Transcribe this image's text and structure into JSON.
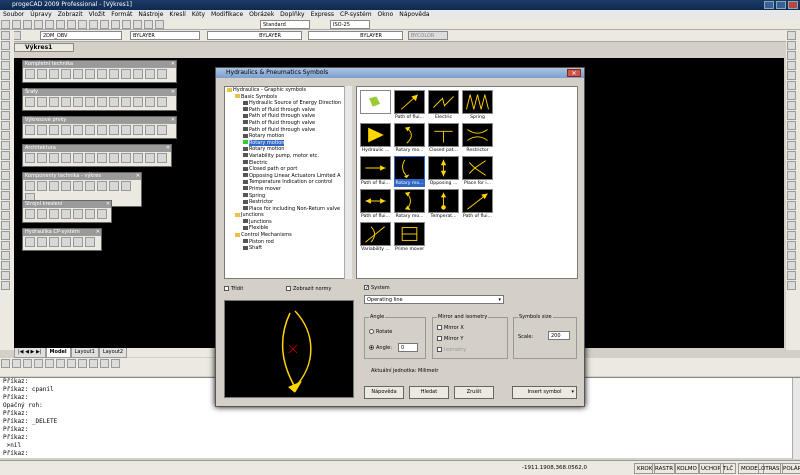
{
  "app": {
    "title": "progeCAD 2009 Professional - [Výkres1]"
  },
  "menu": [
    "Soubor",
    "Úpravy",
    "Zobrazit",
    "Vložit",
    "Formát",
    "Nástroje",
    "Kreslí",
    "Kóty",
    "Modifikace",
    "Obrázek",
    "Doplňky",
    "Express",
    "CP-systém",
    "Okno",
    "Nápověda"
  ],
  "toolbar": {
    "layer": "2DM_OBV",
    "color": "BYLAYER",
    "linetype": "BYLAYER",
    "lineweight": "BYLAYER",
    "plotstyle": "BYCOLOR",
    "textstyle": "Standard",
    "dimstyle": "ISO-25"
  },
  "doc_tab": "Výkres1",
  "palettes": [
    "Kompletní technika",
    "Šrafy",
    "Výkresové prvky",
    "Architektura",
    "Komponenty technika - výkres",
    "Strojní kreslení",
    "Hydraulika CP-systém"
  ],
  "dialog": {
    "title": "Hydraulics & Pneumatics Symbols",
    "tree": [
      {
        "label": "Hydraulics - Graphic symbols",
        "lvl": 0,
        "type": "folder"
      },
      {
        "label": "Basic Symbols",
        "lvl": 1,
        "type": "folder"
      },
      {
        "label": "Hydraulic Source of Energy Direction",
        "lvl": 2,
        "type": "item"
      },
      {
        "label": "Path of fluid through valve",
        "lvl": 2,
        "type": "item"
      },
      {
        "label": "Path of fluid through valve",
        "lvl": 2,
        "type": "item"
      },
      {
        "label": "Path of fluid through valve",
        "lvl": 2,
        "type": "item"
      },
      {
        "label": "Path of fluid through valve",
        "lvl": 2,
        "type": "item"
      },
      {
        "label": "Rotary motion",
        "lvl": 2,
        "type": "item"
      },
      {
        "label": "Rotary motion",
        "lvl": 2,
        "type": "item",
        "selected": true
      },
      {
        "label": "Rotary motion",
        "lvl": 2,
        "type": "item"
      },
      {
        "label": "Variability pump, motor etc.",
        "lvl": 2,
        "type": "item"
      },
      {
        "label": "Electric",
        "lvl": 2,
        "type": "item"
      },
      {
        "label": "Closed path or port",
        "lvl": 2,
        "type": "item"
      },
      {
        "label": "Opposing Linear Actuators Limited A",
        "lvl": 2,
        "type": "item"
      },
      {
        "label": "Temperature Indication or control",
        "lvl": 2,
        "type": "item"
      },
      {
        "label": "Prime mover",
        "lvl": 2,
        "type": "item"
      },
      {
        "label": "Spring",
        "lvl": 2,
        "type": "item"
      },
      {
        "label": "Restrictor",
        "lvl": 2,
        "type": "item"
      },
      {
        "label": "Place for including Non-Return valve",
        "lvl": 2,
        "type": "item"
      },
      {
        "label": "Junctions",
        "lvl": 1,
        "type": "folder"
      },
      {
        "label": "Junctions",
        "lvl": 2,
        "type": "item"
      },
      {
        "label": "Flexible",
        "lvl": 2,
        "type": "item"
      },
      {
        "label": "Control Mechanisms",
        "lvl": 1,
        "type": "folder"
      },
      {
        "label": "Piston rod",
        "lvl": 2,
        "type": "item"
      },
      {
        "label": "Shaft",
        "lvl": 2,
        "type": "item"
      }
    ],
    "symbols": [
      {
        "label": "",
        "kind": "open"
      },
      {
        "label": "Path of flui...",
        "kind": "arrow-diag"
      },
      {
        "label": "Electric",
        "kind": "electric"
      },
      {
        "label": "Spring",
        "kind": "spring"
      },
      {
        "label": "Hydraulic ...",
        "kind": "triangle"
      },
      {
        "label": "Rotary mo...",
        "kind": "arc"
      },
      {
        "label": "Closed pat...",
        "kind": "tee"
      },
      {
        "label": "Restrictor",
        "kind": "restrictor"
      },
      {
        "label": "Path of flui...",
        "kind": "arrow-h"
      },
      {
        "label": "Rotary mo...",
        "kind": "arc2",
        "selected": true
      },
      {
        "label": "Opposing ...",
        "kind": "opposing"
      },
      {
        "label": "Place for i...",
        "kind": "check"
      },
      {
        "label": "Path of flui...",
        "kind": "arrow-both"
      },
      {
        "label": "Rotary mo...",
        "kind": "arc3"
      },
      {
        "label": "Temperat...",
        "kind": "thermo"
      },
      {
        "label": "Path of flui...",
        "kind": "arrow-diag2"
      },
      {
        "label": "Variability ...",
        "kind": "var"
      },
      {
        "label": "Prime mover",
        "kind": "motor"
      }
    ],
    "trid": "Třídit",
    "show_names": "Zobrazit normy",
    "preview_label": "Rotary motion",
    "system_label": "System",
    "layer_value": "Operating line",
    "angle": {
      "title": "Angle",
      "rotate": "Rotate",
      "angle": "Angle:",
      "value": "0"
    },
    "mirror": {
      "title": "Mirror and isometry",
      "x": "Mirror X",
      "y": "Mirror Y",
      "iso": "Isometry"
    },
    "size": {
      "title": "Symbols size",
      "scale": "Scale:",
      "value": "200"
    },
    "unit_label": "Aktuální jednotka: Milimetr",
    "buttons": {
      "help": "Nápověda",
      "search": "Hledat",
      "cancel": "Zrušit",
      "insert": "Insert symbol"
    }
  },
  "layout_tabs": [
    "Model",
    "Layout1",
    "Layout2"
  ],
  "command_lines": [
    "Příkaz:",
    "Příkaz: cpanil",
    "Příkaz:",
    "Opačný roh:",
    "Příkaz:",
    "Příkaz: _DELETE",
    "Příkaz:",
    "Příkaz:",
    " >nil",
    "Příkaz:"
  ],
  "status": {
    "coords": "-1911.1908,368.0562,0",
    "toggles": [
      "KROK",
      "RASTR",
      "KOLMO",
      "UCHOP",
      "TLČ",
      "MODEL",
      "OTRAS",
      "POLÁR"
    ]
  }
}
